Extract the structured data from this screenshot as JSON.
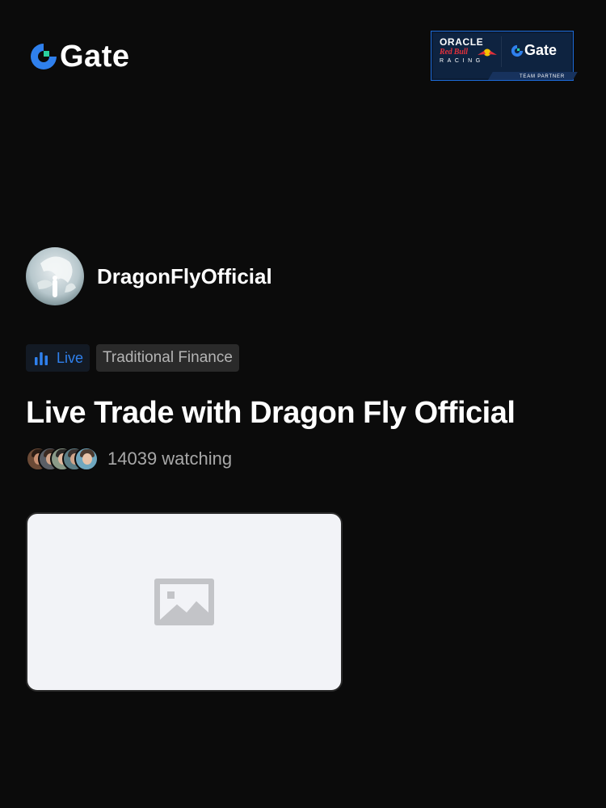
{
  "header": {
    "logo_text": "Gate",
    "brand_color": "#2f80ed",
    "partner_badge": {
      "oracle_text": "ORACLE",
      "redbull_text": "Red Bull",
      "racing_text": "RACING",
      "gate_text": "Gate",
      "team_text": "TEAM PARTNER"
    }
  },
  "host": {
    "name": "DragonFlyOfficial",
    "avatar_icon": "dragon-avatar"
  },
  "tags": {
    "live_label": "Live",
    "category_label": "Traditional Finance",
    "live_color": "#2f80ed"
  },
  "stream": {
    "title": "Live Trade with Dragon Fly Official",
    "watching_text": "14039 watching",
    "viewer_avatars": [
      "viewer-avatar",
      "viewer-avatar",
      "viewer-avatar",
      "viewer-avatar",
      "viewer-avatar"
    ]
  },
  "preview": {
    "placeholder_icon": "image-placeholder-icon"
  }
}
